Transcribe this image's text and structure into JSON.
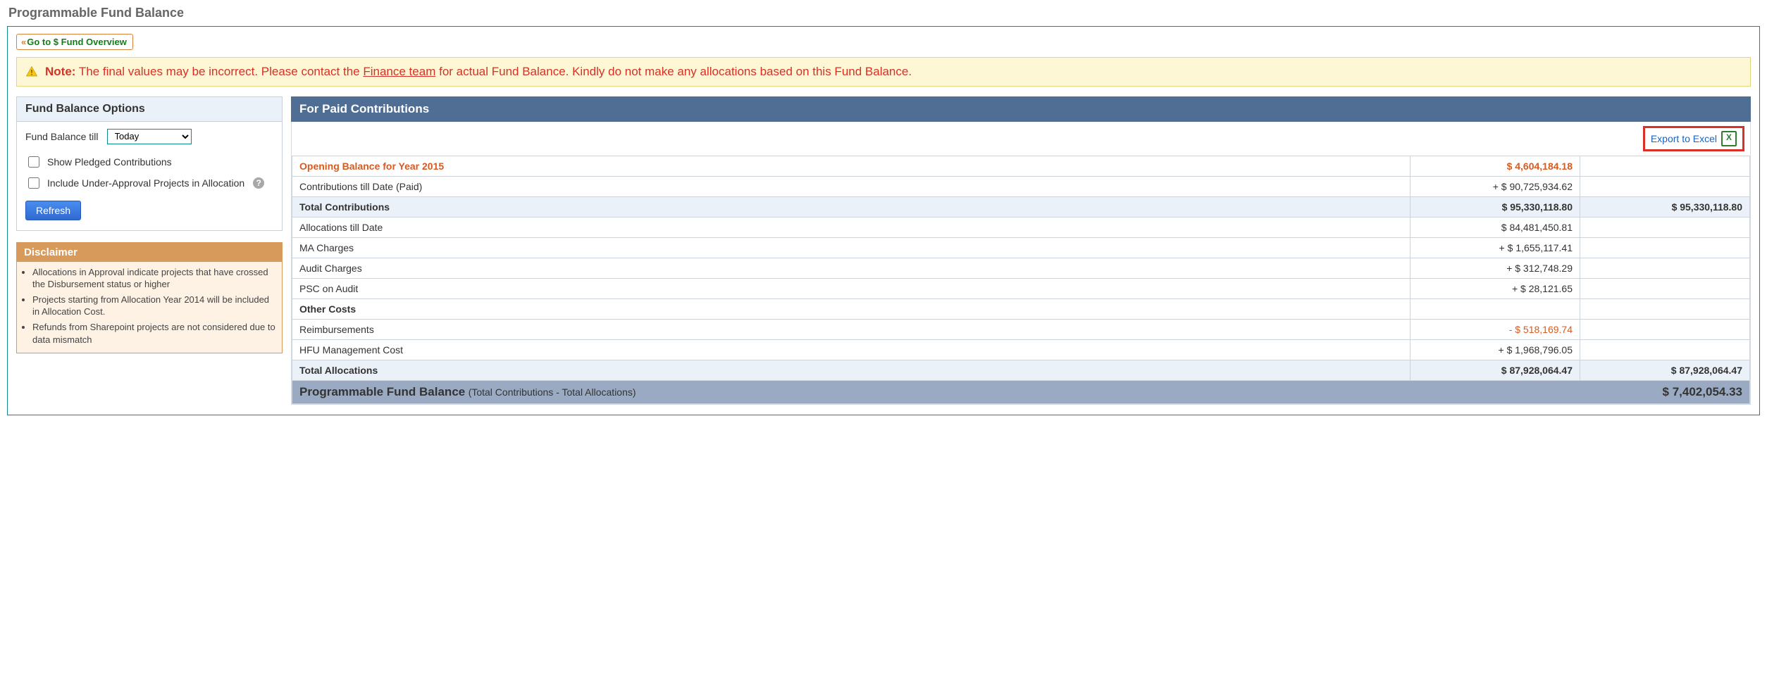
{
  "page_title": "Programmable Fund Balance",
  "top_link_label": "Go to $ Fund Overview",
  "warning": {
    "note_label": "Note:",
    "text_before": "The final values may be incorrect. Please contact the ",
    "link_text": "Finance team",
    "text_after": " for actual Fund Balance. Kindly do not make any allocations based on this Fund Balance."
  },
  "options": {
    "header": "Fund Balance Options",
    "till_label": "Fund Balance till",
    "till_value": "Today",
    "chk_pledged": "Show Pledged Contributions",
    "chk_under_approval": "Include Under-Approval Projects in Allocation",
    "refresh": "Refresh"
  },
  "disclaimer": {
    "header": "Disclaimer",
    "items": [
      "Allocations in Approval indicate projects that have crossed the Disbursement status or higher",
      "Projects starting from Allocation Year 2014 will be included in Allocation Cost.",
      "Refunds from Sharepoint projects are not considered due to data mismatch"
    ]
  },
  "paid": {
    "header": "For Paid Contributions",
    "export_label": "Export to Excel"
  },
  "table": {
    "opening_label": "Opening Balance for Year 2015",
    "opening_value": "$ 4,604,184.18",
    "contrib_till_label": "Contributions till Date (Paid)",
    "contrib_till_value": "+ $ 90,725,934.62",
    "total_contrib_label": "Total Contributions",
    "total_contrib_value": "$ 95,330,118.80",
    "total_contrib_value2": "$ 95,330,118.80",
    "alloc_till_label": "Allocations till Date",
    "alloc_till_value": "$ 84,481,450.81",
    "ma_label": "MA Charges",
    "ma_value": "+ $ 1,655,117.41",
    "audit_label": "Audit Charges",
    "audit_value": "+ $ 312,748.29",
    "psc_label": "PSC on Audit",
    "psc_value": "+ $ 28,121.65",
    "other_label": "Other Costs",
    "reimb_label": "Reimbursements",
    "reimb_value": "- $ 518,169.74",
    "hfu_label": "HFU Management Cost",
    "hfu_value": "+ $ 1,968,796.05",
    "total_alloc_label": "Total Allocations",
    "total_alloc_value": "$ 87,928,064.47",
    "total_alloc_value2": "$ 87,928,064.47",
    "pfb_label": "Programmable Fund Balance",
    "pfb_formula": "(Total Contributions - Total Allocations)",
    "pfb_value": "$ 7,402,054.33"
  }
}
